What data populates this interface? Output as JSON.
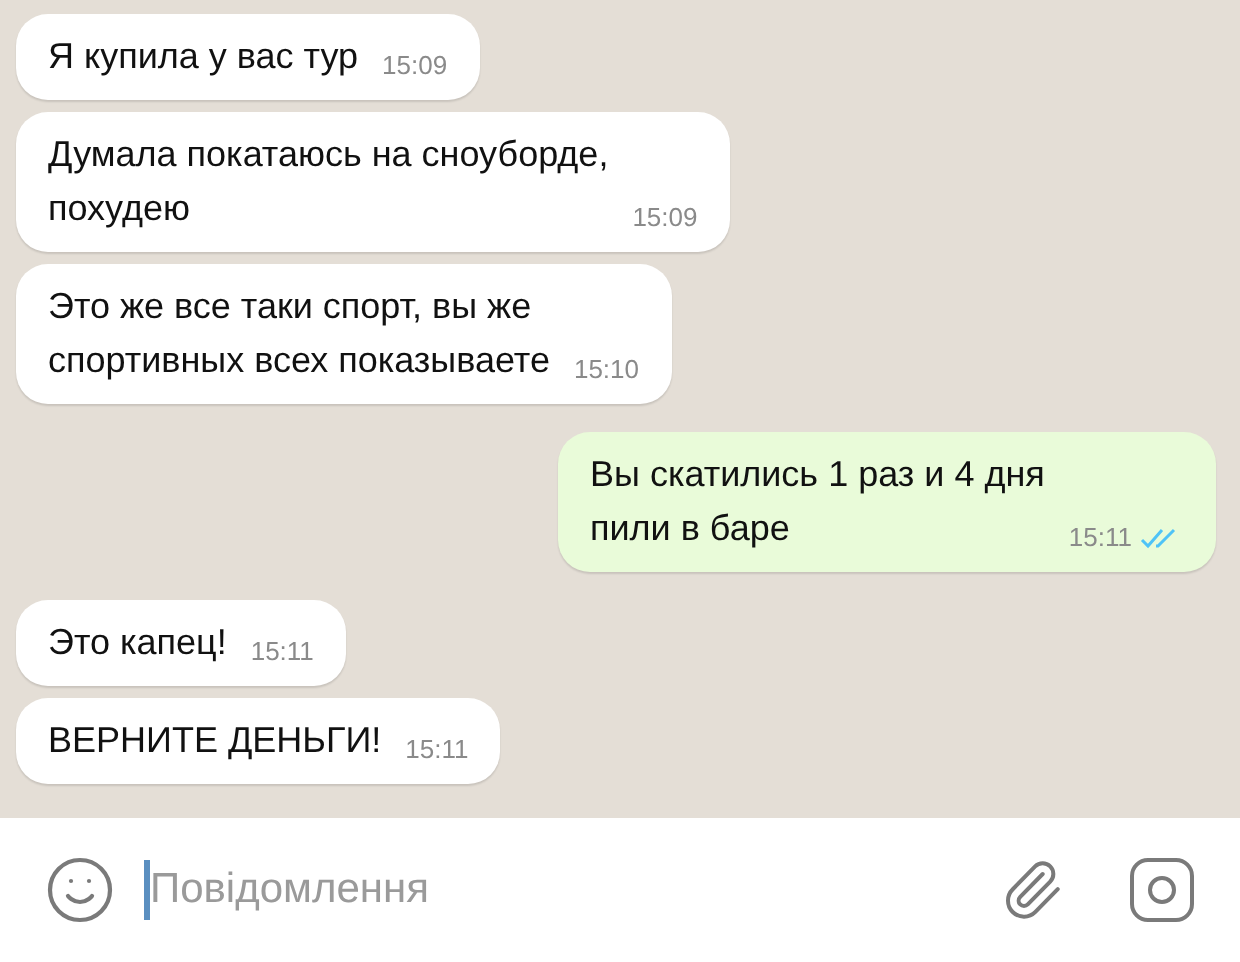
{
  "messages": [
    {
      "kind": "incoming",
      "text": "Я купила у вас тур",
      "time": "15:09"
    },
    {
      "kind": "incoming",
      "text": "Думала покатаюсь на сноуборде,\nпохудею",
      "time": "15:09"
    },
    {
      "kind": "incoming",
      "text": "Это же все таки спорт, вы же\nспортивных всех показываете",
      "time": "15:10"
    },
    {
      "kind": "outgoing",
      "text": "Вы скатились 1 раз и 4 дня\nпили в баре",
      "time": "15:11",
      "read": true
    },
    {
      "kind": "incoming",
      "text": "Это капец!",
      "time": "15:11"
    },
    {
      "kind": "incoming",
      "text": "ВЕРНИТЕ ДЕНЬГИ!",
      "time": "15:11"
    }
  ],
  "composer": {
    "placeholder": "Повідомлення"
  }
}
